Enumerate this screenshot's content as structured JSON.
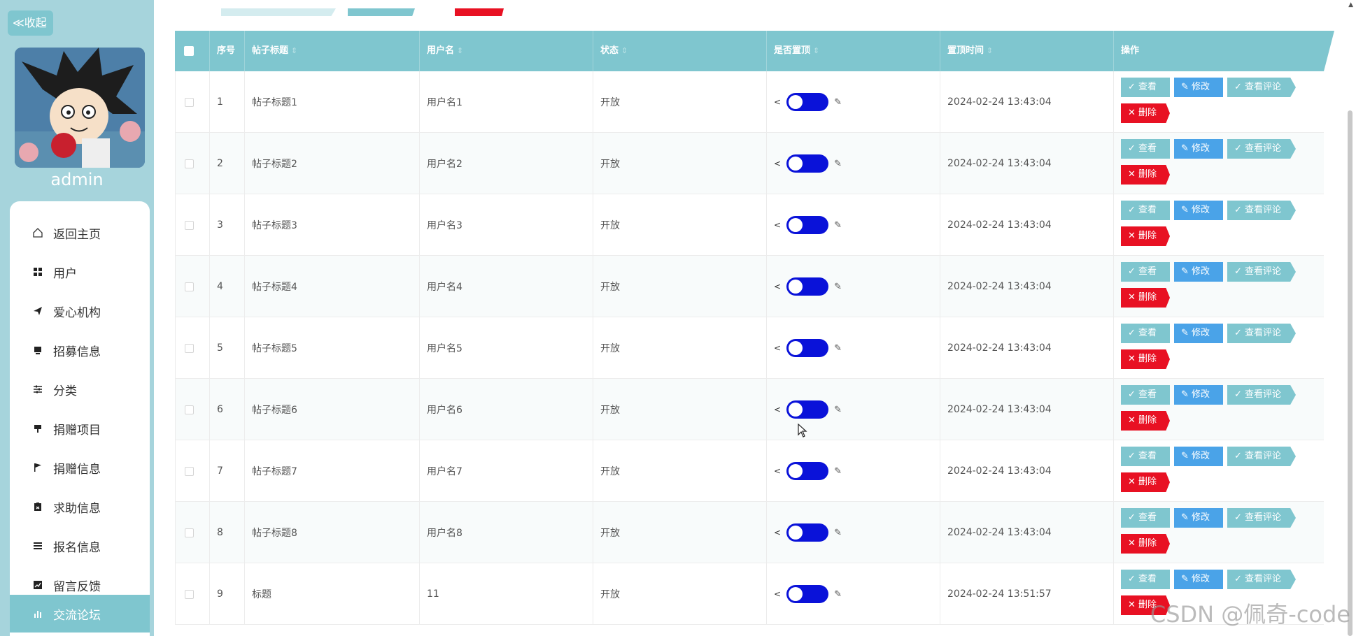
{
  "sidebar": {
    "collapse_label": "≪收起",
    "admin_name": "admin",
    "items": [
      {
        "label": "返回主页",
        "icon": "home-icon"
      },
      {
        "label": "用户",
        "icon": "grid-icon"
      },
      {
        "label": "爱心机构",
        "icon": "send-icon"
      },
      {
        "label": "招募信息",
        "icon": "card-icon"
      },
      {
        "label": "分类",
        "icon": "sliders-icon"
      },
      {
        "label": "捐赠项目",
        "icon": "cup-icon"
      },
      {
        "label": "捐赠信息",
        "icon": "flag-icon"
      },
      {
        "label": "求助信息",
        "icon": "clipboard-icon"
      },
      {
        "label": "报名信息",
        "icon": "list-icon"
      },
      {
        "label": "留言反馈",
        "icon": "chart-icon"
      },
      {
        "label": "交流论坛",
        "icon": "bar-chart-icon",
        "active": true
      }
    ]
  },
  "table": {
    "headers": {
      "index": "序号",
      "title": "帖子标题",
      "username": "用户名",
      "status": "状态",
      "pinned": "是否置顶",
      "pinned_time": "置顶时间",
      "actions": "操作"
    },
    "sort_glyph": "⇕",
    "rows": [
      {
        "index": "1",
        "title": "帖子标题1",
        "username": "用户名1",
        "status": "开放",
        "pinned_time": "2024-02-24 13:43:04"
      },
      {
        "index": "2",
        "title": "帖子标题2",
        "username": "用户名2",
        "status": "开放",
        "pinned_time": "2024-02-24 13:43:04"
      },
      {
        "index": "3",
        "title": "帖子标题3",
        "username": "用户名3",
        "status": "开放",
        "pinned_time": "2024-02-24 13:43:04"
      },
      {
        "index": "4",
        "title": "帖子标题4",
        "username": "用户名4",
        "status": "开放",
        "pinned_time": "2024-02-24 13:43:04"
      },
      {
        "index": "5",
        "title": "帖子标题5",
        "username": "用户名5",
        "status": "开放",
        "pinned_time": "2024-02-24 13:43:04"
      },
      {
        "index": "6",
        "title": "帖子标题6",
        "username": "用户名6",
        "status": "开放",
        "pinned_time": "2024-02-24 13:43:04"
      },
      {
        "index": "7",
        "title": "帖子标题7",
        "username": "用户名7",
        "status": "开放",
        "pinned_time": "2024-02-24 13:43:04"
      },
      {
        "index": "8",
        "title": "帖子标题8",
        "username": "用户名8",
        "status": "开放",
        "pinned_time": "2024-02-24 13:43:04"
      },
      {
        "index": "9",
        "title": "标题",
        "username": "11",
        "status": "开放",
        "pinned_time": "2024-02-24 13:51:57"
      }
    ],
    "actions": {
      "view": "✓ 查看",
      "edit": "✎ 修改",
      "comments": "✓ 查看评论",
      "delete": "✕ 删除"
    },
    "share_glyph": "<",
    "pen_glyph": "✎"
  },
  "colors": {
    "accent": "#7fc6cf",
    "sidebar_bg": "#a6d4dc",
    "edit_blue": "#4aa3e8",
    "delete_red": "#e81123",
    "toggle_blue": "#0a12d9"
  },
  "watermark": "CSDN @佩奇-code"
}
